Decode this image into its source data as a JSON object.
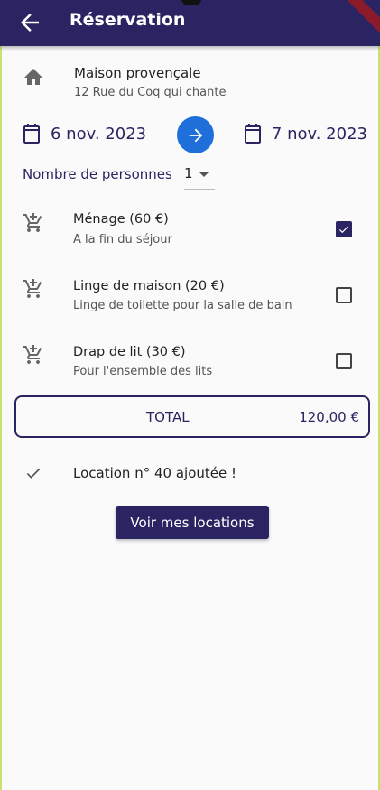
{
  "appbar": {
    "title": "Réservation"
  },
  "property": {
    "name": "Maison provençale",
    "address": "12 Rue du Coq qui chante"
  },
  "dates": {
    "start": "6 nov. 2023",
    "end": "7 nov. 2023"
  },
  "persons": {
    "label": "Nombre de personnes",
    "value": "1"
  },
  "options": [
    {
      "title": "Ménage (60 €)",
      "subtitle": "A la fin du séjour",
      "checked": true
    },
    {
      "title": "Linge de maison (20 €)",
      "subtitle": "Linge de toilette pour la salle de bain",
      "checked": false
    },
    {
      "title": "Drap de lit (30 €)",
      "subtitle": "Pour l'ensemble des lits",
      "checked": false
    }
  ],
  "total": {
    "label": "TOTAL",
    "amount": "120,00 €"
  },
  "confirmation": {
    "text": "Location n° 40 ajoutée !"
  },
  "actions": {
    "view_locations": "Voir mes locations"
  },
  "colors": {
    "primary": "#2b2462",
    "accent": "#1e6fd9",
    "background": "#fafafa"
  },
  "icons": {
    "back": "arrow-left-icon",
    "house": "house-icon",
    "calendar": "calendar-icon",
    "arrow": "arrow-right-icon",
    "cart": "add-shopping-cart-icon",
    "check": "check-icon"
  }
}
